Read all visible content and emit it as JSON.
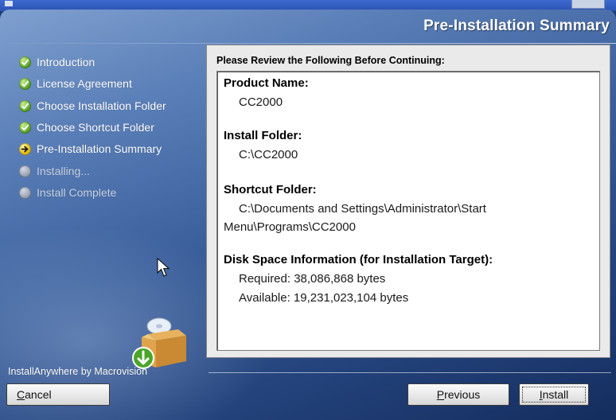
{
  "header": {
    "title": "Pre-Installation Summary"
  },
  "steps": [
    {
      "label": "Introduction",
      "status": "complete",
      "icon": "check-icon"
    },
    {
      "label": "License Agreement",
      "status": "complete",
      "icon": "check-icon"
    },
    {
      "label": "Choose Installation Folder",
      "status": "complete",
      "icon": "check-icon"
    },
    {
      "label": "Choose Shortcut Folder",
      "status": "complete",
      "icon": "check-icon"
    },
    {
      "label": "Pre-Installation Summary",
      "status": "current",
      "icon": "arrow-right-icon"
    },
    {
      "label": "Installing...",
      "status": "pending",
      "icon": "pending-dot-icon"
    },
    {
      "label": "Install Complete",
      "status": "pending",
      "icon": "pending-dot-icon"
    }
  ],
  "panel": {
    "heading": "Please Review the Following Before Continuing:",
    "product_name": {
      "label": "Product Name:",
      "value": "CC2000"
    },
    "install_folder": {
      "label": "Install Folder:",
      "value": "C:\\CC2000"
    },
    "shortcut_folder": {
      "label": "Shortcut Folder:",
      "value_line1": "C:\\Documents and Settings\\Administrator\\Start",
      "value_line2": "Menu\\Programs\\CC2000"
    },
    "disk_space": {
      "label": "Disk Space Information (for Installation Target):",
      "required": "Required: 38,086,868 bytes",
      "available": "Available: 19,231,023,104 bytes"
    }
  },
  "footer": {
    "brand": "InstallAnywhere by Macrovision",
    "cancel": {
      "mnemonic": "C",
      "rest": "ancel"
    },
    "previous": {
      "mnemonic": "P",
      "rest": "revious"
    },
    "install": {
      "mnemonic": "I",
      "rest": "nstall"
    }
  },
  "colors": {
    "check": "#4f9a1d",
    "current": "#e0b400",
    "pending": "#8e97a8",
    "panel_bg": "#eaeaea"
  }
}
